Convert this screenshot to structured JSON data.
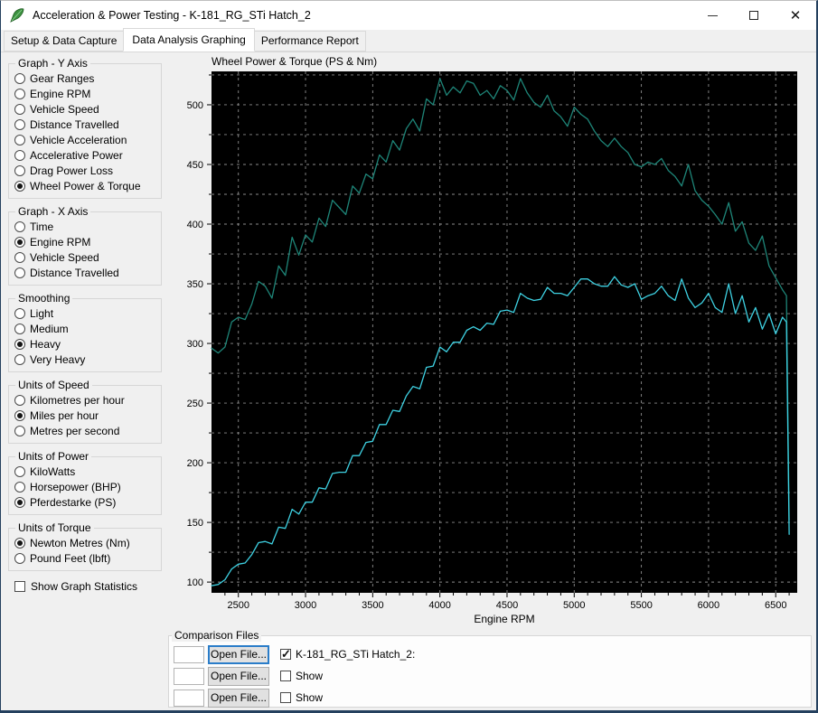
{
  "window": {
    "title": "Acceleration & Power Testing - K-181_RG_STi Hatch_2",
    "controls": {
      "minimize": "minimize",
      "maximize": "maximize",
      "close": "close"
    }
  },
  "tabs": [
    {
      "label": "Setup & Data Capture",
      "active": false
    },
    {
      "label": "Data Analysis Graphing",
      "active": true
    },
    {
      "label": "Performance Report",
      "active": false
    }
  ],
  "sidebar": {
    "groups": [
      {
        "title": "Graph - Y Axis",
        "options": [
          {
            "label": "Gear Ranges",
            "selected": false
          },
          {
            "label": "Engine RPM",
            "selected": false
          },
          {
            "label": "Vehicle Speed",
            "selected": false
          },
          {
            "label": "Distance Travelled",
            "selected": false
          },
          {
            "label": "Vehicle Acceleration",
            "selected": false
          },
          {
            "label": "Accelerative Power",
            "selected": false
          },
          {
            "label": "Drag Power Loss",
            "selected": false
          },
          {
            "label": "Wheel Power & Torque",
            "selected": true
          }
        ]
      },
      {
        "title": "Graph - X Axis",
        "options": [
          {
            "label": "Time",
            "selected": false
          },
          {
            "label": "Engine RPM",
            "selected": true
          },
          {
            "label": "Vehicle Speed",
            "selected": false
          },
          {
            "label": "Distance Travelled",
            "selected": false
          }
        ]
      },
      {
        "title": "Smoothing",
        "options": [
          {
            "label": "Light",
            "selected": false
          },
          {
            "label": "Medium",
            "selected": false
          },
          {
            "label": "Heavy",
            "selected": true
          },
          {
            "label": "Very Heavy",
            "selected": false
          }
        ]
      },
      {
        "title": "Units of Speed",
        "options": [
          {
            "label": "Kilometres per hour",
            "selected": false
          },
          {
            "label": "Miles per hour",
            "selected": true
          },
          {
            "label": "Metres per second",
            "selected": false
          }
        ]
      },
      {
        "title": "Units of Power",
        "options": [
          {
            "label": "KiloWatts",
            "selected": false
          },
          {
            "label": "Horsepower (BHP)",
            "selected": false
          },
          {
            "label": "Pferdestarke (PS)",
            "selected": true
          }
        ]
      },
      {
        "title": "Units of Torque",
        "options": [
          {
            "label": "Newton Metres (Nm)",
            "selected": true
          },
          {
            "label": "Pound Feet (lbft)",
            "selected": false
          }
        ]
      }
    ],
    "statistics": {
      "label": "Show Graph Statistics",
      "checked": false
    }
  },
  "chart_data": {
    "type": "line",
    "title": "Wheel Power & Torque (PS & Nm)",
    "xlabel": "Engine RPM",
    "ylabel": "",
    "xlim": [
      2300,
      6660
    ],
    "ylim": [
      91,
      528
    ],
    "x_tick_labels": [
      "2500",
      "3000",
      "3500",
      "4000",
      "4500",
      "5000",
      "5500",
      "6000",
      "6500"
    ],
    "y_tick_labels": [
      "100",
      "150",
      "200",
      "250",
      "300",
      "350",
      "400",
      "450",
      "500"
    ],
    "grid": {
      "x_major_step": 500,
      "y_grid_step": 25,
      "x_minor_step": 100,
      "y_minor_step": 25,
      "style": "dashed"
    },
    "colors": {
      "plot_background": "#000000",
      "gridline": "#8c8c8c",
      "axis_text": "#000000"
    },
    "x": [
      2300,
      2350,
      2400,
      2450,
      2500,
      2550,
      2600,
      2650,
      2700,
      2750,
      2800,
      2850,
      2900,
      2950,
      3000,
      3050,
      3100,
      3150,
      3200,
      3250,
      3300,
      3350,
      3400,
      3450,
      3500,
      3550,
      3600,
      3650,
      3700,
      3750,
      3800,
      3850,
      3900,
      3950,
      4000,
      4050,
      4100,
      4150,
      4200,
      4250,
      4300,
      4350,
      4400,
      4450,
      4500,
      4550,
      4600,
      4650,
      4700,
      4750,
      4800,
      4850,
      4900,
      4950,
      5000,
      5050,
      5100,
      5150,
      5200,
      5250,
      5300,
      5350,
      5400,
      5450,
      5500,
      5550,
      5600,
      5650,
      5700,
      5750,
      5800,
      5850,
      5900,
      5950,
      6000,
      6050,
      6100,
      6150,
      6200,
      6250,
      6300,
      6350,
      6400,
      6450,
      6500,
      6550,
      6580,
      6600
    ],
    "series": [
      {
        "name": "Wheel Torque (Nm)",
        "color": "#1e8578",
        "values": [
          296,
          292,
          297,
          318,
          322,
          320,
          333,
          352,
          348,
          338,
          365,
          357,
          389,
          374,
          391,
          385,
          405,
          398,
          420,
          414,
          408,
          432,
          426,
          442,
          438,
          458,
          452,
          470,
          462,
          480,
          488,
          478,
          505,
          500,
          522,
          508,
          515,
          510,
          520,
          518,
          508,
          512,
          505,
          516,
          512,
          504,
          522,
          510,
          502,
          498,
          508,
          495,
          490,
          482,
          498,
          492,
          488,
          478,
          470,
          465,
          472,
          465,
          460,
          450,
          448,
          452,
          450,
          455,
          445,
          440,
          432,
          450,
          428,
          420,
          415,
          408,
          400,
          418,
          394,
          402,
          384,
          378,
          390,
          365,
          355,
          345,
          340,
          152
        ]
      },
      {
        "name": "Wheel Power (PS)",
        "color": "#3ed1e2",
        "values": [
          97,
          98,
          102,
          111,
          115,
          116,
          123,
          133,
          134,
          132,
          146,
          145,
          161,
          157,
          167,
          167,
          179,
          178,
          191,
          192,
          192,
          206,
          206,
          217,
          218,
          232,
          232,
          244,
          243,
          256,
          264,
          262,
          280,
          281,
          297,
          293,
          301,
          301,
          311,
          314,
          311,
          317,
          316,
          327,
          328,
          326,
          342,
          338,
          336,
          337,
          347,
          342,
          342,
          340,
          347,
          354,
          354,
          350,
          348,
          348,
          356,
          349,
          347,
          350,
          337,
          340,
          342,
          348,
          340,
          336,
          354,
          338,
          330,
          334,
          342,
          330,
          326,
          350,
          325,
          340,
          318,
          330,
          312,
          325,
          308,
          322,
          318,
          140
        ]
      }
    ],
    "legend": "none"
  },
  "comparison": {
    "title": "Comparison Files",
    "rows": [
      {
        "field_value": "",
        "button": "Open File...",
        "checkbox_label": "K-181_RG_STi Hatch_2:",
        "checked": true,
        "focused": true
      },
      {
        "field_value": "",
        "button": "Open File...",
        "checkbox_label": "Show",
        "checked": false,
        "focused": false
      },
      {
        "field_value": "",
        "button": "Open File...",
        "checkbox_label": "Show",
        "checked": false,
        "focused": false
      }
    ]
  }
}
